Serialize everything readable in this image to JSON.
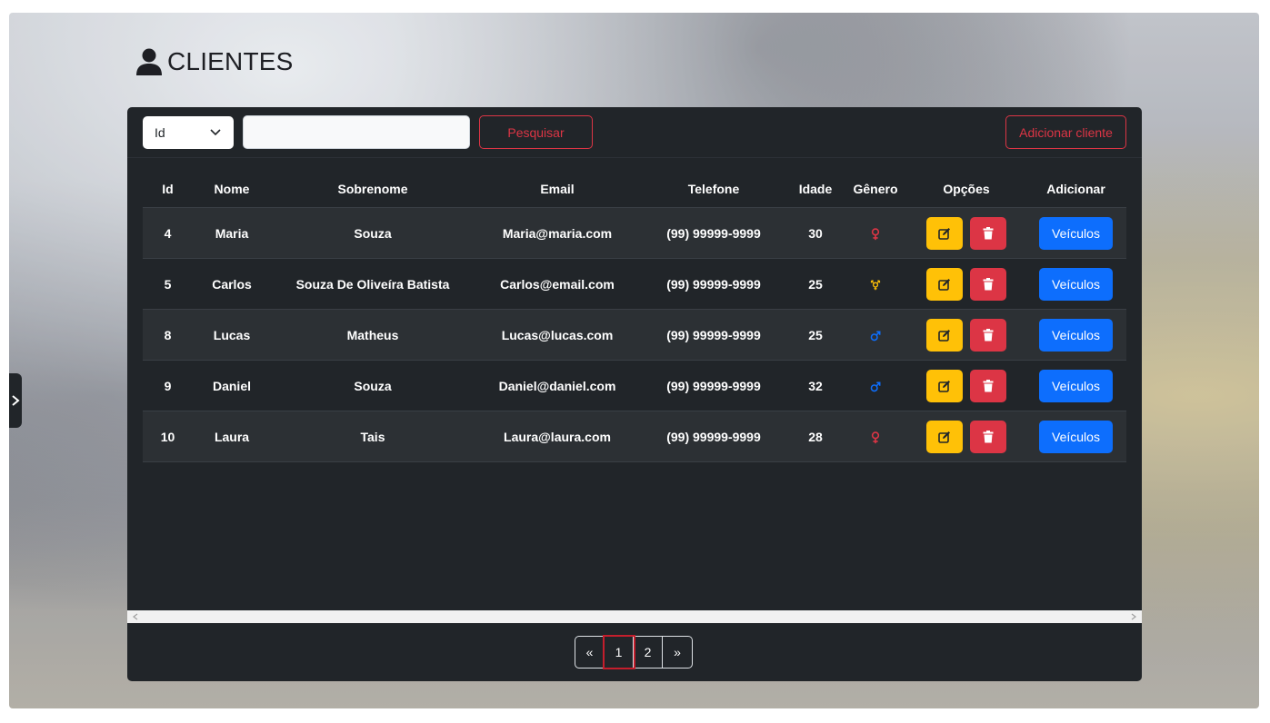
{
  "page": {
    "title": "CLIENTES"
  },
  "toolbar": {
    "filter_selected": "Id",
    "search_value": "",
    "search_placeholder": "",
    "search_button": "Pesquisar",
    "add_button": "Adicionar cliente"
  },
  "table": {
    "headers": [
      "Id",
      "Nome",
      "Sobrenome",
      "Email",
      "Telefone",
      "Idade",
      "Gênero",
      "Opções",
      "Adicionar"
    ],
    "rows": [
      {
        "id": "4",
        "nome": "Maria",
        "sobrenome": "Souza",
        "email": "Maria@maria.com",
        "telefone": "(99) 99999-9999",
        "idade": "30",
        "genero": "female",
        "action": "Veículos"
      },
      {
        "id": "5",
        "nome": "Carlos",
        "sobrenome": "Souza De Oliveíra Batista",
        "email": "Carlos@email.com",
        "telefone": "(99) 99999-9999",
        "idade": "25",
        "genero": "transgender",
        "action": "Veículos"
      },
      {
        "id": "8",
        "nome": "Lucas",
        "sobrenome": "Matheus",
        "email": "Lucas@lucas.com",
        "telefone": "(99) 99999-9999",
        "idade": "25",
        "genero": "male",
        "action": "Veículos"
      },
      {
        "id": "9",
        "nome": "Daniel",
        "sobrenome": "Souza",
        "email": "Daniel@daniel.com",
        "telefone": "(99) 99999-9999",
        "idade": "32",
        "genero": "male",
        "action": "Veículos"
      },
      {
        "id": "10",
        "nome": "Laura",
        "sobrenome": "Tais",
        "email": "Laura@laura.com",
        "telefone": "(99) 99999-9999",
        "idade": "28",
        "genero": "female",
        "action": "Veículos"
      }
    ]
  },
  "pagination": {
    "prev": "«",
    "pages": [
      "1",
      "2"
    ],
    "active": "1",
    "next": "»"
  },
  "colors": {
    "female": "#dc3545",
    "male": "#0d6efd",
    "transgender": "#ffc107",
    "edit": "#ffc107",
    "delete": "#dc3545",
    "primary": "#0d6efd",
    "panel": "#212529"
  }
}
